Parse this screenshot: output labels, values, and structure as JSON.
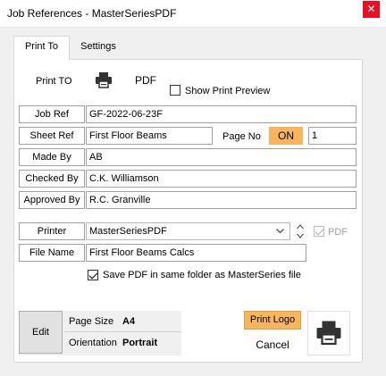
{
  "window": {
    "title": "Job References - MasterSeriesPDF",
    "close_glyph": "✕"
  },
  "tabs": [
    {
      "label": "Print To",
      "active": true
    },
    {
      "label": "Settings",
      "active": false
    }
  ],
  "print_to": {
    "label": "Print TO",
    "pdf_button_label": "PDF",
    "show_preview_label": "Show Print Preview",
    "show_preview_checked": false
  },
  "fields": {
    "job_ref": {
      "label": "Job Ref",
      "value": "GF-2022-06-23F"
    },
    "sheet_ref": {
      "label": "Sheet Ref",
      "value": "First Floor Beams"
    },
    "page_no": {
      "label": "Page No",
      "toggle": "ON",
      "value": "1"
    },
    "made_by": {
      "label": "Made By",
      "value": "AB"
    },
    "checked_by": {
      "label": "Checked By",
      "value": "C.K. Williamson"
    },
    "approved_by": {
      "label": "Approved By",
      "value": "R.C. Granville"
    }
  },
  "printer": {
    "label": "Printer",
    "selected": "MasterSeriesPDF",
    "pdf_check_label": "PDF",
    "pdf_checked": true
  },
  "file_name": {
    "label": "File Name",
    "value": "First Floor Beams Calcs"
  },
  "save_pdf": {
    "label": "Save PDF in same folder as MasterSeries file",
    "checked": true
  },
  "page_setup": {
    "edit_label": "Edit",
    "page_size_label": "Page Size",
    "page_size_value": "A4",
    "orientation_label": "Orientation",
    "orientation_value": "Portrait"
  },
  "actions": {
    "print_logo_label": "Print Logo",
    "cancel_label": "Cancel"
  },
  "colors": {
    "accent_orange": "#f7b65e",
    "close_red": "#e81123"
  }
}
